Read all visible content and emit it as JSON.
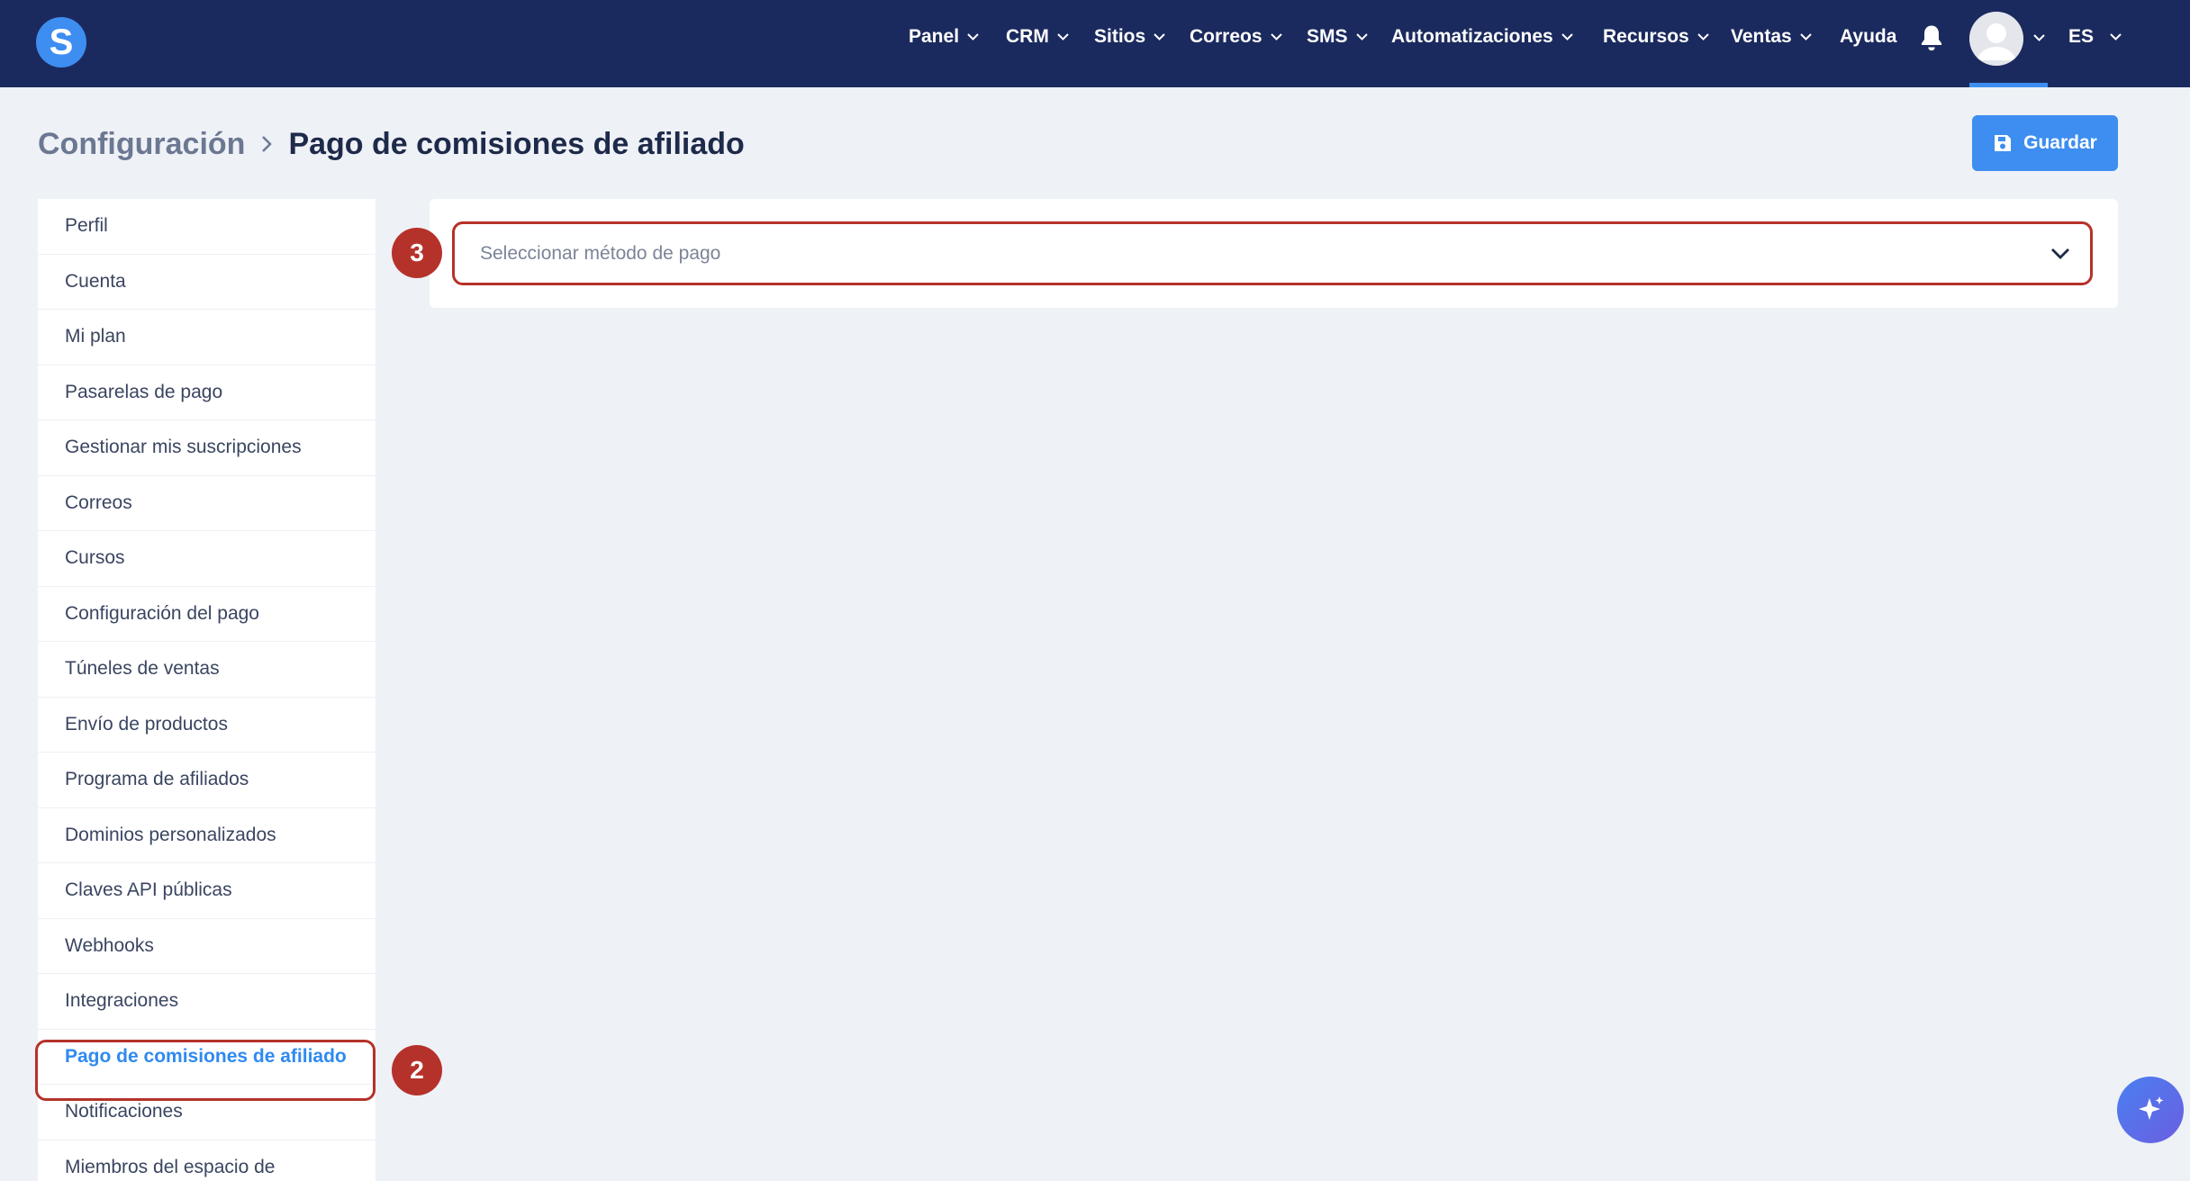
{
  "app": {
    "logo_letter": "S",
    "brand_color": "#3d8ef0",
    "header_color": "#1b2a5e"
  },
  "nav": {
    "items": [
      {
        "label": "Panel",
        "has_dropdown": true
      },
      {
        "label": "CRM",
        "has_dropdown": true
      },
      {
        "label": "Sitios",
        "has_dropdown": true
      },
      {
        "label": "Correos",
        "has_dropdown": true
      },
      {
        "label": "SMS",
        "has_dropdown": true
      },
      {
        "label": "Automatizaciones",
        "has_dropdown": true
      },
      {
        "label": "Recursos",
        "has_dropdown": true
      },
      {
        "label": "Ventas",
        "has_dropdown": true
      },
      {
        "label": "Ayuda",
        "has_dropdown": false
      }
    ],
    "notifications_icon": "bell-icon",
    "avatar_icon": "user-avatar-icon",
    "language": "ES"
  },
  "breadcrumb": {
    "root": "Configuración",
    "current": "Pago de comisiones de afiliado"
  },
  "toolbar": {
    "save_label": "Guardar",
    "save_icon": "floppy-disk-icon"
  },
  "sidebar": {
    "items": [
      {
        "label": "Perfil"
      },
      {
        "label": "Cuenta"
      },
      {
        "label": "Mi plan"
      },
      {
        "label": "Pasarelas de pago"
      },
      {
        "label": "Gestionar mis suscripciones"
      },
      {
        "label": "Correos"
      },
      {
        "label": "Cursos"
      },
      {
        "label": "Configuración del pago"
      },
      {
        "label": "Túneles de ventas"
      },
      {
        "label": "Envío de productos"
      },
      {
        "label": "Programa de afiliados"
      },
      {
        "label": "Dominios personalizados"
      },
      {
        "label": "Claves API públicas"
      },
      {
        "label": "Webhooks"
      },
      {
        "label": "Integraciones"
      },
      {
        "label": "Pago de comisiones de afiliado",
        "active": true
      },
      {
        "label": "Notificaciones"
      },
      {
        "label": "Miembros del espacio de"
      }
    ]
  },
  "payment_method": {
    "placeholder": "Seleccionar método de pago",
    "icon": "chevron-down-icon"
  },
  "annotations": {
    "step_2": "2",
    "step_3": "3",
    "highlight_color": "#b5322a"
  },
  "assistant": {
    "icon": "sparkle-icon"
  }
}
